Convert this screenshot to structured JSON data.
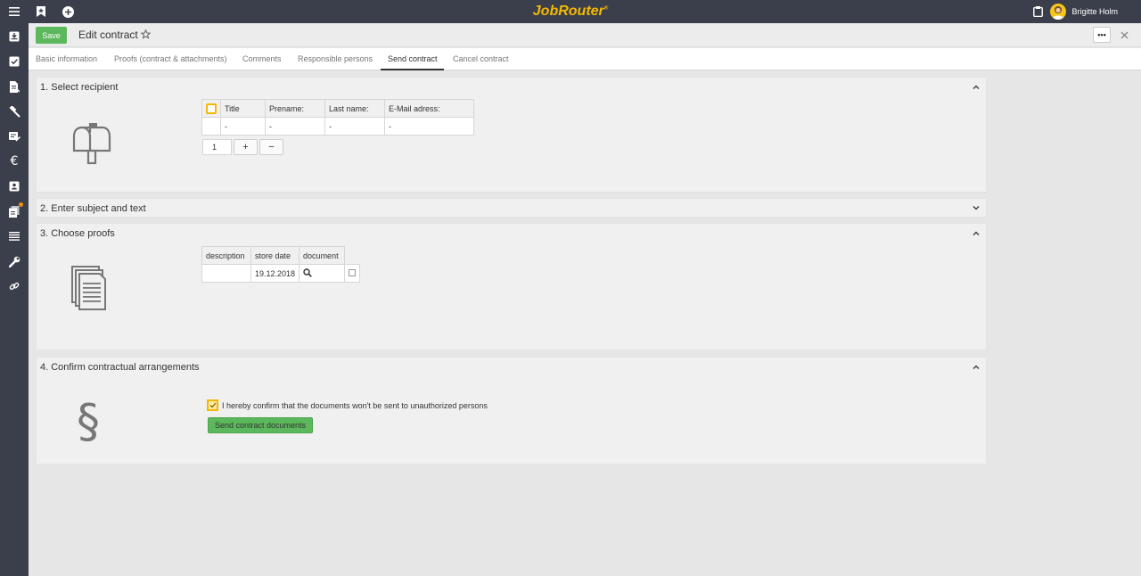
{
  "app": {
    "logo": "JobRouter",
    "logo_mark": "®"
  },
  "user": {
    "name": "Brigitte Holm"
  },
  "header": {
    "save_label": "Save",
    "title": "Edit contract",
    "more_label": "•••"
  },
  "tabs": [
    {
      "label": "Basic information"
    },
    {
      "label": "Proofs (contract & attachments)"
    },
    {
      "label": "Comments"
    },
    {
      "label": "Responsible persons"
    },
    {
      "label": "Send contract"
    },
    {
      "label": "Cancel contract"
    }
  ],
  "sections": {
    "recipient": {
      "title": "1. Select recipient",
      "columns": [
        "Title",
        "Prename:",
        "Last name:",
        "E-Mail adress:"
      ],
      "row": [
        "-",
        "-",
        "-",
        "-"
      ],
      "stepper": {
        "value": "1",
        "plus": "+",
        "minus": "−"
      }
    },
    "subject": {
      "title": "2. Enter subject and text"
    },
    "proofs": {
      "title": "3. Choose proofs",
      "columns": [
        "description",
        "store date",
        "document"
      ],
      "row": {
        "description": "",
        "store_date": "19.12.2018"
      }
    },
    "confirm": {
      "title": "4. Confirm contractual arrangements",
      "checkbox_label": "I hereby confirm that the documents won't be sent to unauthorized persons",
      "send_label": "Send contract documents",
      "symbol": "§"
    }
  },
  "colors": {
    "accent": "#f5b800",
    "primary_button": "#5cb85c",
    "dark_bar": "#3b3f4c",
    "notification": "#f28c00"
  }
}
